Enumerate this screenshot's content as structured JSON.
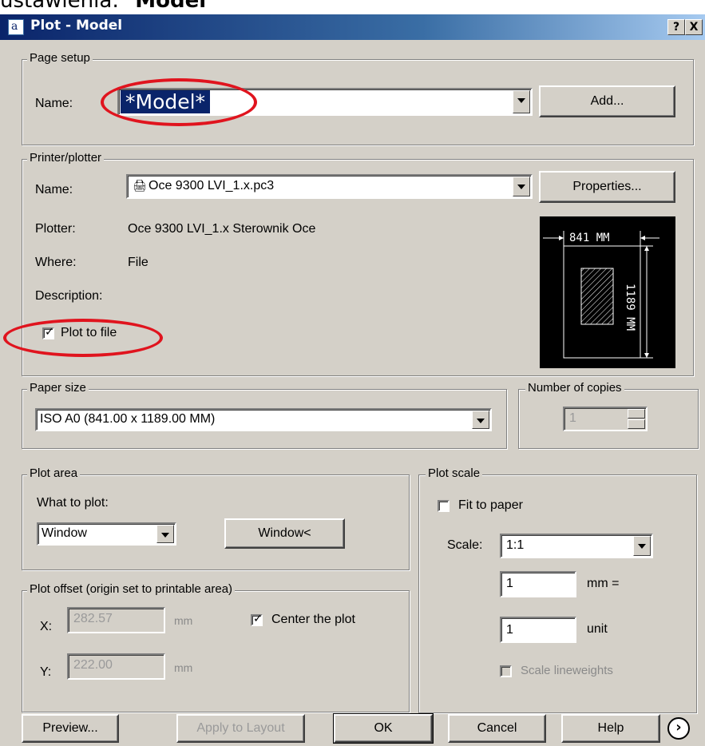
{
  "caption": {
    "prefix": "ustawienia:",
    "bold": "Model"
  },
  "window": {
    "title": "Plot - Model",
    "help_btn": "?",
    "close_btn": "X",
    "app_icon": "autocad-icon"
  },
  "page_setup": {
    "group": "Page setup",
    "name_label": "Name:",
    "name_value": "*Model*",
    "add_button": "Add..."
  },
  "printer": {
    "group": "Printer/plotter",
    "name_label": "Name:",
    "name_value": "Oce 9300 LVI_1.x.pc3",
    "properties_button": "Properties...",
    "plotter_label": "Plotter:",
    "plotter_value": "Oce 9300 LVI_1.x Sterownik Oce",
    "where_label": "Where:",
    "where_value": "File",
    "description_label": "Description:",
    "plot_to_file": "Plot to file",
    "plot_to_file_checked": true,
    "preview": {
      "width_label": "841 MM",
      "height_label": "1189 MM"
    }
  },
  "paper_size": {
    "group": "Paper size",
    "value": "ISO A0 (841.00 x 1189.00 MM)"
  },
  "copies": {
    "group": "Number of copies",
    "value": "1"
  },
  "plot_area": {
    "group": "Plot area",
    "what_label": "What to plot:",
    "what_value": "Window",
    "window_button": "Window<"
  },
  "plot_offset": {
    "group": "Plot offset (origin set to printable area)",
    "x_label": "X:",
    "x_value": "282.57",
    "x_unit": "mm",
    "y_label": "Y:",
    "y_value": "222.00",
    "y_unit": "mm",
    "center_label": "Center the plot",
    "center_checked": true
  },
  "plot_scale": {
    "group": "Plot scale",
    "fit_label": "Fit to paper",
    "fit_checked": false,
    "scale_label": "Scale:",
    "scale_value": "1:1",
    "mm_value": "1",
    "mm_label": "mm =",
    "unit_value": "1",
    "unit_label": "unit",
    "lineweights_label": "Scale lineweights",
    "lineweights_checked": false
  },
  "footer": {
    "preview": "Preview...",
    "apply": "Apply to Layout",
    "ok": "OK",
    "cancel": "Cancel",
    "help": "Help",
    "expand_icon": "chevron-right-circle-icon"
  },
  "colors": {
    "title_gradient_start": "#0a246a",
    "highlight": "#0a246a",
    "annotation_red": "#e0141e",
    "dialog_bg": "#d4d0c8"
  }
}
